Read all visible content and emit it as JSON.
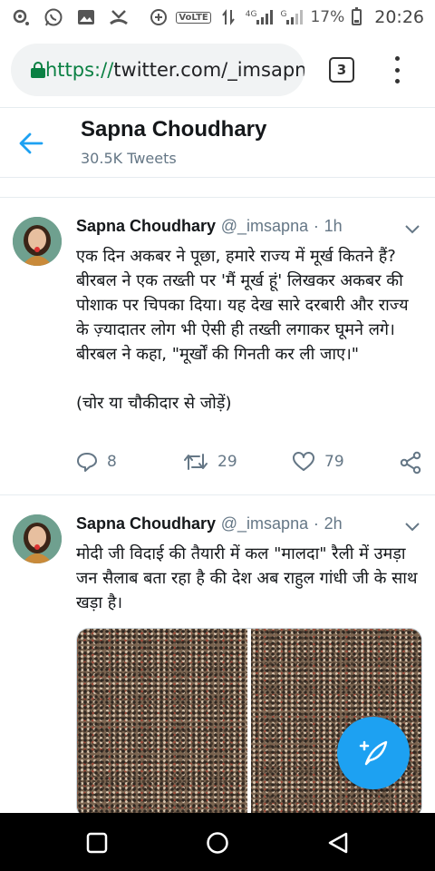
{
  "status_bar": {
    "time": "20:26",
    "battery": "17%",
    "network_label": "VoLTE",
    "signal1_label": "4G",
    "signal2_label": "G"
  },
  "browser": {
    "url_scheme": "https://",
    "url_rest": "twitter.com/_imsapna",
    "tab_count": "3"
  },
  "header": {
    "name": "Sapna Choudhary",
    "tweet_count": "30.5K Tweets"
  },
  "tweets": [
    {
      "name": "Sapna Choudhary",
      "handle": "@_imsapna",
      "dot": "·",
      "time": "1h",
      "text": "एक दिन अकबर ने पूछा, हमारे राज्य में मूर्ख कितने हैं? बीरबल ने एक तख्ती पर 'मैं मूर्ख हूं' लिखकर अकबर की पोशाक पर चिपका दिया। यह देख सारे दरबारी और राज्य के ज़्यादातर लोग भी ऐसी ही तख्ती लगाकर घूमने लगे। बीरबल ने कहा, \"मूर्खों की गिनती कर ली जाए।\"\n\n(चोर या चौकीदार से जोड़ें)",
      "replies": "8",
      "retweets": "29",
      "likes": "79"
    },
    {
      "name": "Sapna Choudhary",
      "handle": "@_imsapna",
      "dot": "·",
      "time": "2h",
      "text": "मोदी जी विदाई की तैयारी में कल \"मालदा\" रैली में उमड़ा जन सैलाब बता रहा है की देश अब राहुल गांधी जी के साथ खड़ा है।"
    }
  ],
  "colors": {
    "accent": "#1da1f2",
    "secure_green": "#0b8043",
    "muted": "#657786"
  }
}
